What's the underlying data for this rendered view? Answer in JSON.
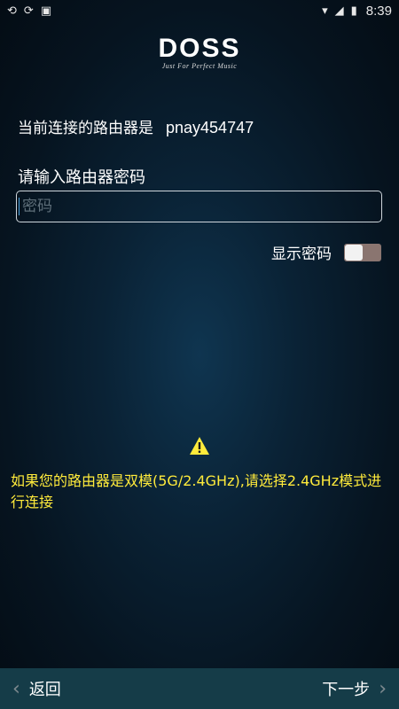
{
  "status_bar": {
    "left_icons": [
      "sync-icon",
      "sync-icon",
      "text-icon"
    ],
    "right_icons": [
      "wifi-icon",
      "signal-icon",
      "battery-icon"
    ],
    "time": "8:39"
  },
  "logo": {
    "brand": "DOSS",
    "tagline": "Just For Perfect Music"
  },
  "router": {
    "label": "当前连接的路由器是",
    "ssid": "pnay454747"
  },
  "password": {
    "label": "请输入路由器密码",
    "placeholder": "密码",
    "value": ""
  },
  "show_password": {
    "label": "显示密码",
    "enabled": false
  },
  "warning": {
    "icon": "warning-icon",
    "text": "如果您的路由器是双模(5G/2.4GHz),请选择2.4GHz模式进行连接"
  },
  "nav": {
    "back_label": "返回",
    "next_label": "下一步"
  },
  "colors": {
    "warning_text": "#ffeb3b",
    "bottom_bar": "#153c48",
    "toggle_track": "#8a7570"
  }
}
